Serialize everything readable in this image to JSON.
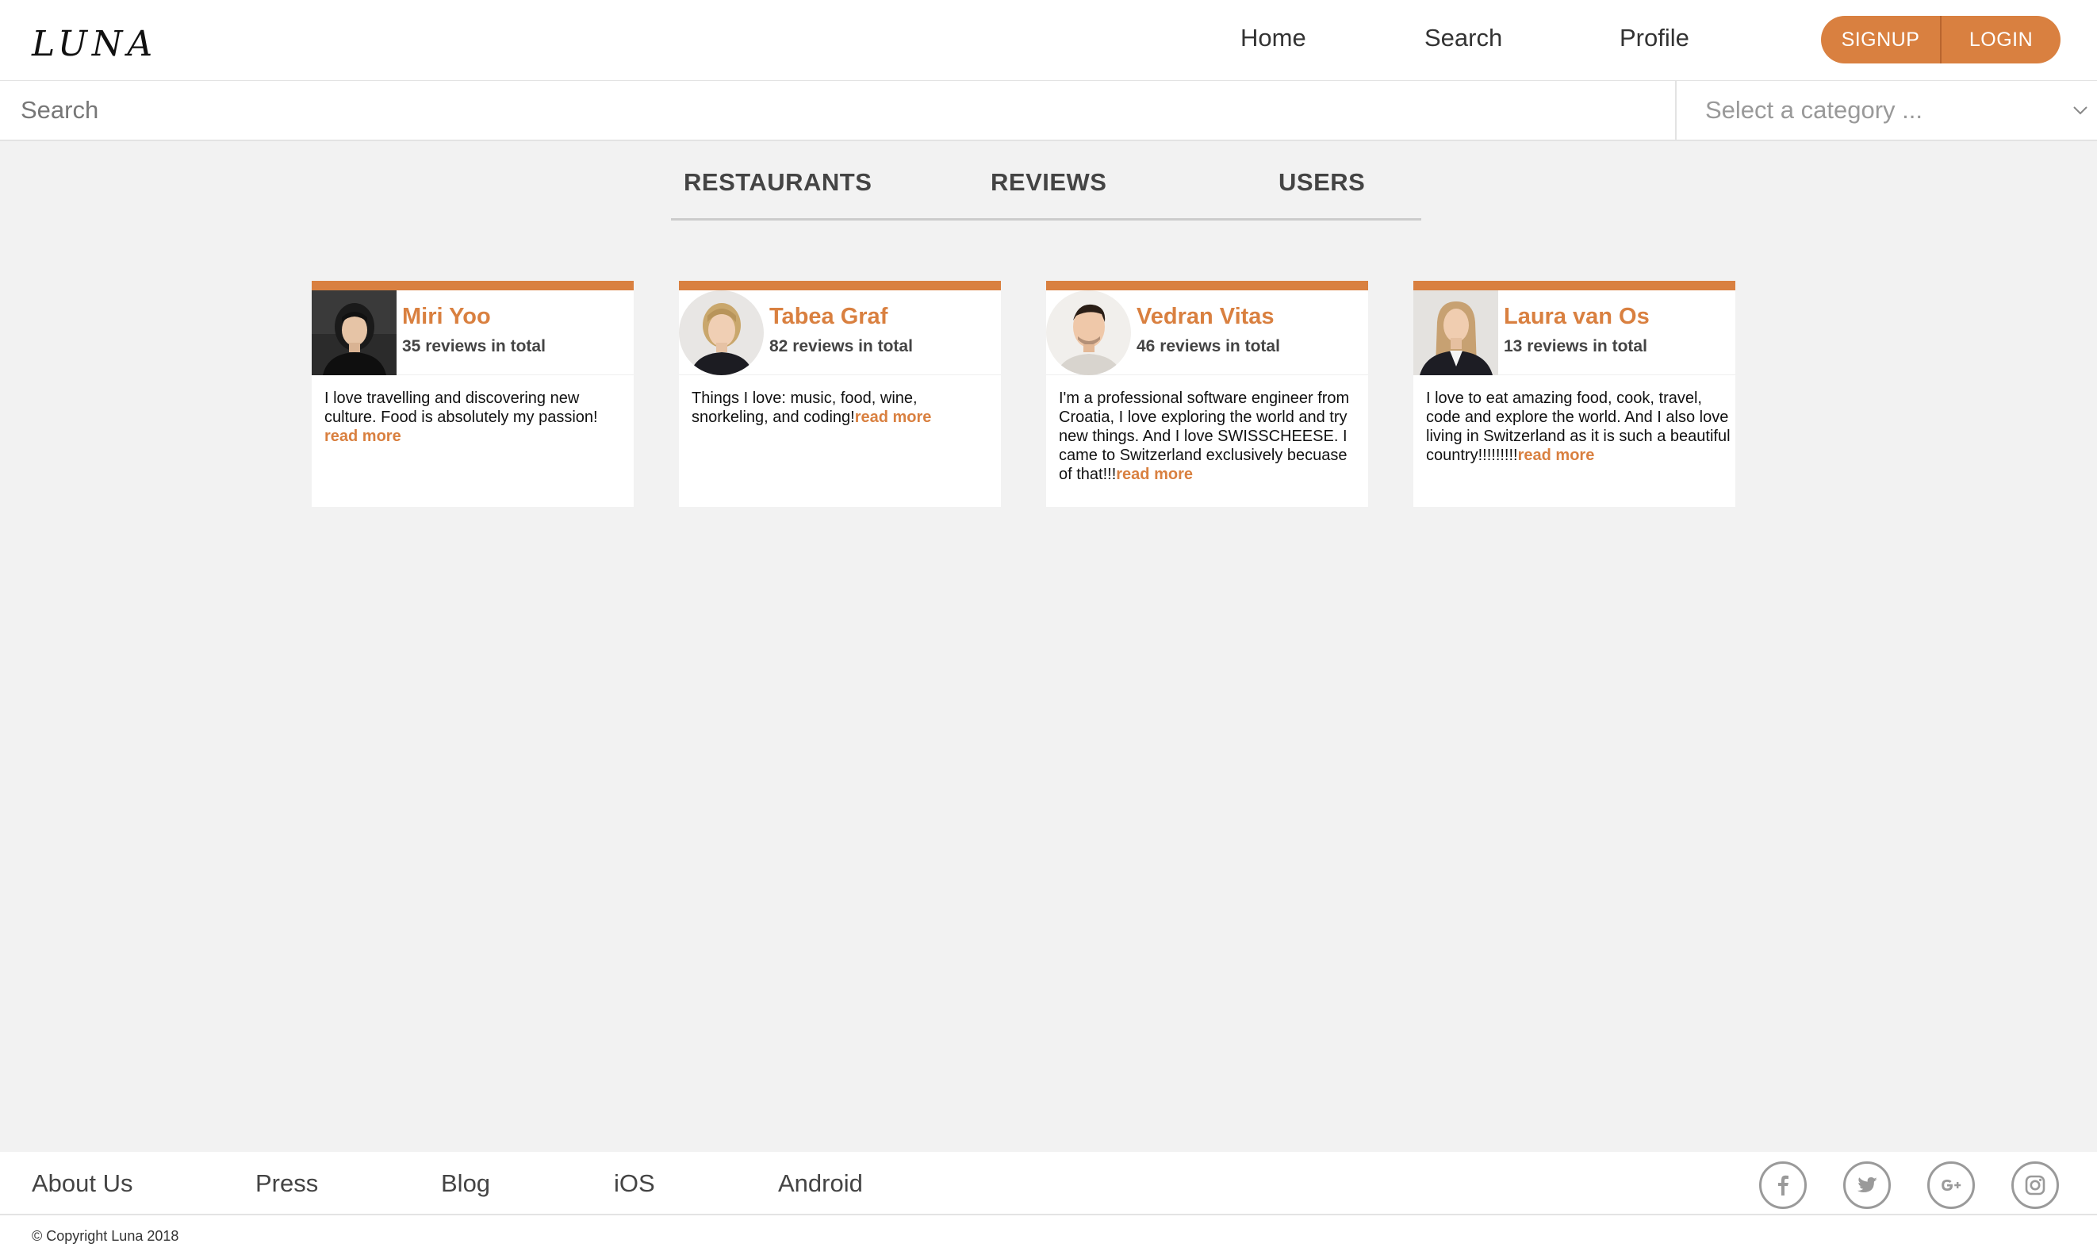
{
  "app": {
    "logo": "LUNA"
  },
  "nav": {
    "items": [
      "Home",
      "Search",
      "Profile"
    ],
    "signup": "SIGNUP",
    "login": "LOGIN"
  },
  "search": {
    "placeholder": "Search",
    "category_placeholder": "Select a category ..."
  },
  "tabs": [
    "RESTAURANTS",
    "REVIEWS",
    "USERS"
  ],
  "users": [
    {
      "name": "Miri Yoo",
      "reviews": "35 reviews in total",
      "bio": "I love travelling and discovering new culture. Food is absolutely my passion!",
      "read_more": "read more",
      "avatar": "woman-dark-hair-portrait-icon"
    },
    {
      "name": "Tabea Graf",
      "reviews": "82 reviews in total",
      "bio": "Things I love: music, food, wine, snorkeling, and coding!",
      "read_more": "read more",
      "avatar": "woman-blonde-portrait-icon"
    },
    {
      "name": "Vedran Vitas",
      "reviews": "46 reviews in total",
      "bio": "I'm a professional software engineer from Croatia, I love exploring the world and try new things. And I love SWISSCHEESE. I came to Switzerland exclusively becuase of that!!!",
      "read_more": "read more",
      "avatar": "man-dark-hair-portrait-icon"
    },
    {
      "name": "Laura van Os",
      "reviews": "13 reviews in total",
      "bio": "I love to eat amazing food, cook, travel, code and explore the world. And I also love living in Switzerland as it is such a beautiful country!!!!!!!!!",
      "read_more": "read more",
      "avatar": "woman-long-blonde-hair-portrait-icon"
    }
  ],
  "footer": {
    "links": [
      "About Us",
      "Press",
      "Blog",
      "iOS",
      "Android"
    ],
    "social": [
      "facebook-icon",
      "twitter-icon",
      "google-plus-icon",
      "instagram-icon"
    ],
    "copyright": "© Copyright Luna 2018"
  },
  "colors": {
    "accent": "#d98040",
    "background": "#f2f2f2"
  }
}
